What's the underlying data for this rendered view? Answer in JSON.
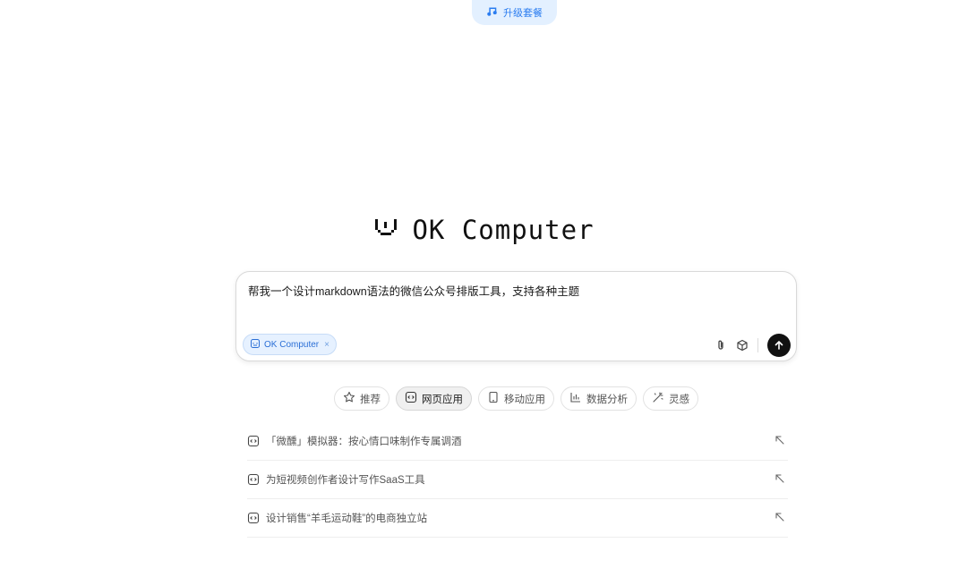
{
  "header": {
    "upgrade_label": "升级套餐",
    "upgrade_icon": "music-note-icon",
    "brand_color": "#2b7df0"
  },
  "hero": {
    "title": "OK Computer",
    "logo_icon": "smiley-face-icon"
  },
  "composer": {
    "prompt_text": "帮我一个设计markdown语法的微信公众号排版工具，支持各种主题",
    "mode_chip": {
      "label": "OK Computer",
      "icon": "ok-computer-icon",
      "remove": "×"
    },
    "tools": [
      {
        "name": "attach",
        "icon": "paperclip-icon"
      },
      {
        "name": "model",
        "icon": "cube-icon"
      },
      {
        "name": "send",
        "icon": "arrow-up-icon"
      }
    ]
  },
  "tabs": [
    {
      "label": "推荐",
      "icon": "star-icon",
      "active": false
    },
    {
      "label": "网页应用",
      "icon": "code-window-icon",
      "active": true
    },
    {
      "label": "移动应用",
      "icon": "phone-icon",
      "active": false
    },
    {
      "label": "数据分析",
      "icon": "bar-chart-icon",
      "active": false
    },
    {
      "label": "灵感",
      "icon": "magic-wand-icon",
      "active": false
    }
  ],
  "suggestions": [
    {
      "text": "「微醺」模拟器：按心情口味制作专属调酒",
      "icon": "code-window-icon"
    },
    {
      "text": "为短视频创作者设计写作SaaS工具",
      "icon": "code-window-icon"
    },
    {
      "text": "设计销售“羊毛运动鞋”的电商独立站",
      "icon": "code-window-icon"
    }
  ]
}
